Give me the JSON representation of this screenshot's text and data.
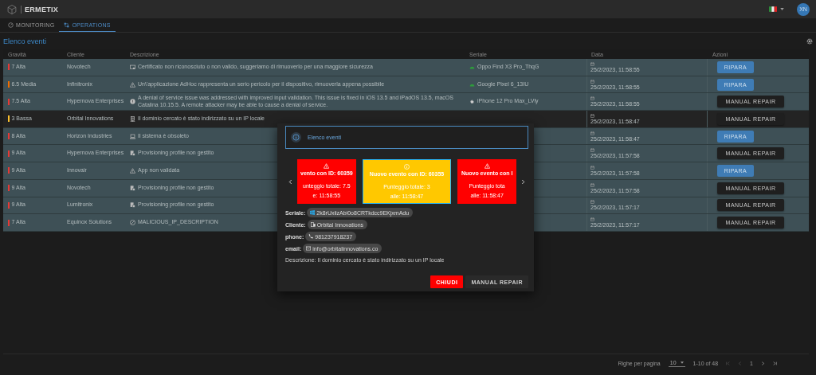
{
  "header": {
    "logo": "ERMETIX",
    "avatar": "XN"
  },
  "tabs": [
    {
      "label": "MONITORING",
      "kind": "gauge",
      "selected": false
    },
    {
      "label": "OPERATIONS",
      "kind": "network",
      "selected": true
    }
  ],
  "page_title": "Elenco eventi",
  "table": {
    "columns": [
      "Gravità",
      "Cliente",
      "Descrizione",
      "Seriale",
      "Data",
      "Azioni"
    ],
    "rows": [
      {
        "gravity": "7 Alta",
        "color": "#e53935",
        "client": "Novotech",
        "kind": "certificate",
        "description": "Certificato non riconosciuto o non valido, suggeriamo di rimuoverlo per una maggiore sicurezza",
        "serial": {
          "kind": "android",
          "text": "Oppo Find X3 Pro_ThqG"
        },
        "date": "25/2/2023, 11:58:55",
        "action": {
          "kind": "ripara",
          "label": "RIPARA"
        },
        "highlighted": true
      },
      {
        "gravity": "6.5 Media",
        "color": "#ef6c00",
        "client": "Infinitronix",
        "kind": "warning",
        "description": "Un\\'applicazione AdHoc rappresenta un serio pericolo per il dispositivo, rimuoverla appena possibile",
        "serial": {
          "kind": "android",
          "text": "Google Pixel 6_13IU"
        },
        "date": "25/2/2023, 11:58:55",
        "action": {
          "kind": "ripara",
          "label": "RIPARA"
        },
        "highlighted": true
      },
      {
        "gravity": "7.5 Alta",
        "color": "#e53935",
        "client": "Hypernova Enterprises",
        "kind": "alert",
        "description": "A denial of service issue was addressed with improved input validation. This issue is fixed in iOS 13.5 and iPadOS 13.5, macOS Catalina 10.15.5. A remote attacker may be able to cause a denial of service.",
        "serial": {
          "kind": "apple",
          "text": "iPhone 12 Pro Max_LVly"
        },
        "date": "25/2/2023, 11:58:55",
        "action": {
          "kind": "manual",
          "label": "MANUAL REPAIR"
        },
        "highlighted": true
      },
      {
        "gravity": "3 Bassa",
        "color": "#fbc02d",
        "client": "Orbital Innovations",
        "kind": "server",
        "description": "Il dominio cercato è stato indirizzato su un IP locale",
        "date": "25/2/2023, 11:58:47",
        "action": {
          "kind": "manual",
          "label": "MANUAL REPAIR"
        },
        "highlighted": false
      },
      {
        "gravity": "8 Alta",
        "color": "#e53935",
        "client": "Horizon Industries",
        "kind": "laptop",
        "description": "Il sistema è obsoleto",
        "date": "25/2/2023, 11:58:47",
        "action": {
          "kind": "ripara",
          "label": "RIPARA"
        },
        "highlighted": true
      },
      {
        "gravity": "9 Alta",
        "color": "#e53935",
        "client": "Hypernova Enterprises",
        "kind": "profile",
        "description": "Provisioning profile non gestito",
        "date": "25/2/2023, 11:57:58",
        "action": {
          "kind": "manual",
          "label": "MANUAL REPAIR"
        },
        "highlighted": true
      },
      {
        "gravity": "9 Alta",
        "color": "#e53935",
        "client": "Innovair",
        "kind": "warning",
        "description": "App non validata",
        "date": "25/2/2023, 11:57:58",
        "action": {
          "kind": "ripara",
          "label": "RIPARA"
        },
        "highlighted": true
      },
      {
        "gravity": "9 Alta",
        "color": "#e53935",
        "client": "Novotech",
        "kind": "profile",
        "description": "Provisioning profile non gestito",
        "date": "25/2/2023, 11:57:58",
        "action": {
          "kind": "manual",
          "label": "MANUAL REPAIR"
        },
        "highlighted": true
      },
      {
        "gravity": "9 Alta",
        "color": "#e53935",
        "client": "Lumitronix",
        "kind": "profile",
        "description": "Provisioning profile non gestito",
        "date": "25/2/2023, 11:57:17",
        "action": {
          "kind": "manual",
          "label": "MANUAL REPAIR"
        },
        "highlighted": true
      },
      {
        "gravity": "7 Alta",
        "color": "#e53935",
        "client": "Equinox Solutions",
        "kind": "block",
        "description": "MALICIOUS_IP_DESCRIPTION",
        "date": "25/2/2023, 11:57:17",
        "action": {
          "kind": "manual",
          "label": "MANUAL REPAIR"
        },
        "highlighted": true
      }
    ]
  },
  "pagination": {
    "rows_label": "Righe per pagina",
    "rows_value": "10",
    "range": "1-10 of 48",
    "page": "1"
  },
  "dialog": {
    "title": "Elenco eventi",
    "cards": [
      {
        "kind": "warning",
        "title": "vento con ID: 60359",
        "score": "unteggio totale: 7.5",
        "time": "e: 11:58:55",
        "selected": false
      },
      {
        "kind": "info",
        "title": "Nuovo evento con ID: 60355",
        "score": "Punteggio totale: 3",
        "time": "alle: 11:58:47",
        "selected": true
      },
      {
        "kind": "warning",
        "title": "Nuovo evento con I",
        "score": "Punteggio tota",
        "time": "alle: 11:58:47",
        "selected": false
      }
    ],
    "fields": [
      {
        "kind": "serial",
        "label": "Seriale:",
        "value": "2k8rUxiizAbi0o8CRTkdcc9EKjxmAdu"
      },
      {
        "kind": "client",
        "label": "Cliente:",
        "value": "Orbital Innovations"
      },
      {
        "kind": "phone",
        "label": "phone:",
        "value": "981237918237"
      },
      {
        "kind": "email",
        "label": "email:",
        "value": "info@orbitalinnovations.co"
      }
    ],
    "description": "Descrizione: Il dominio cercato è stato indirizzato su un IP locale",
    "buttons": [
      {
        "kind": "close",
        "label": "CHIUDI"
      },
      {
        "kind": "manual",
        "label": "MANUAL REPAIR"
      }
    ]
  }
}
